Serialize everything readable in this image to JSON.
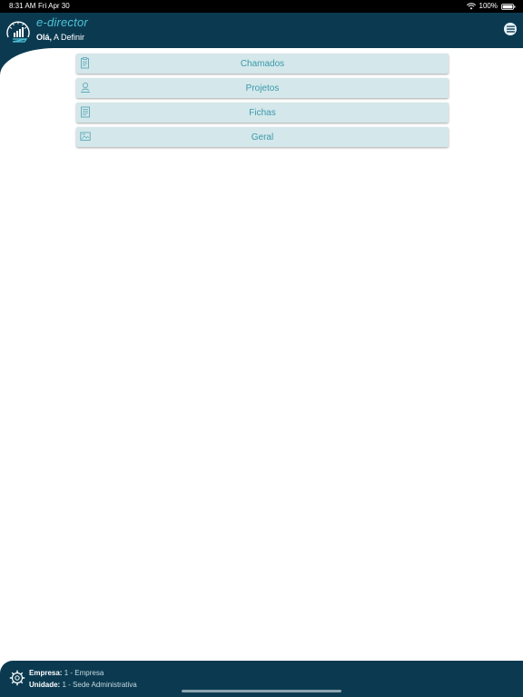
{
  "status_bar": {
    "time": "8:31 AM",
    "date": "Fri Apr 30",
    "battery": "100%"
  },
  "header": {
    "app_title": "e-director",
    "greeting_label": "Olá,",
    "greeting_name": "A Definir"
  },
  "menu": {
    "items": [
      {
        "label": "Chamados",
        "icon": "clipboard-icon"
      },
      {
        "label": "Projetos",
        "icon": "person-stamp-icon"
      },
      {
        "label": "Fichas",
        "icon": "document-list-icon"
      },
      {
        "label": "Geral",
        "icon": "image-card-icon"
      }
    ]
  },
  "footer": {
    "empresa_label": "Empresa:",
    "empresa_value": "1 - Empresa",
    "unidade_label": "Unidade:",
    "unidade_value": "1 - Sede Administrativa"
  },
  "colors": {
    "header_bg": "#0b3a50",
    "accent": "#4ec3d8",
    "item_bg": "#d4e7ea",
    "item_text": "#3a9aac"
  }
}
